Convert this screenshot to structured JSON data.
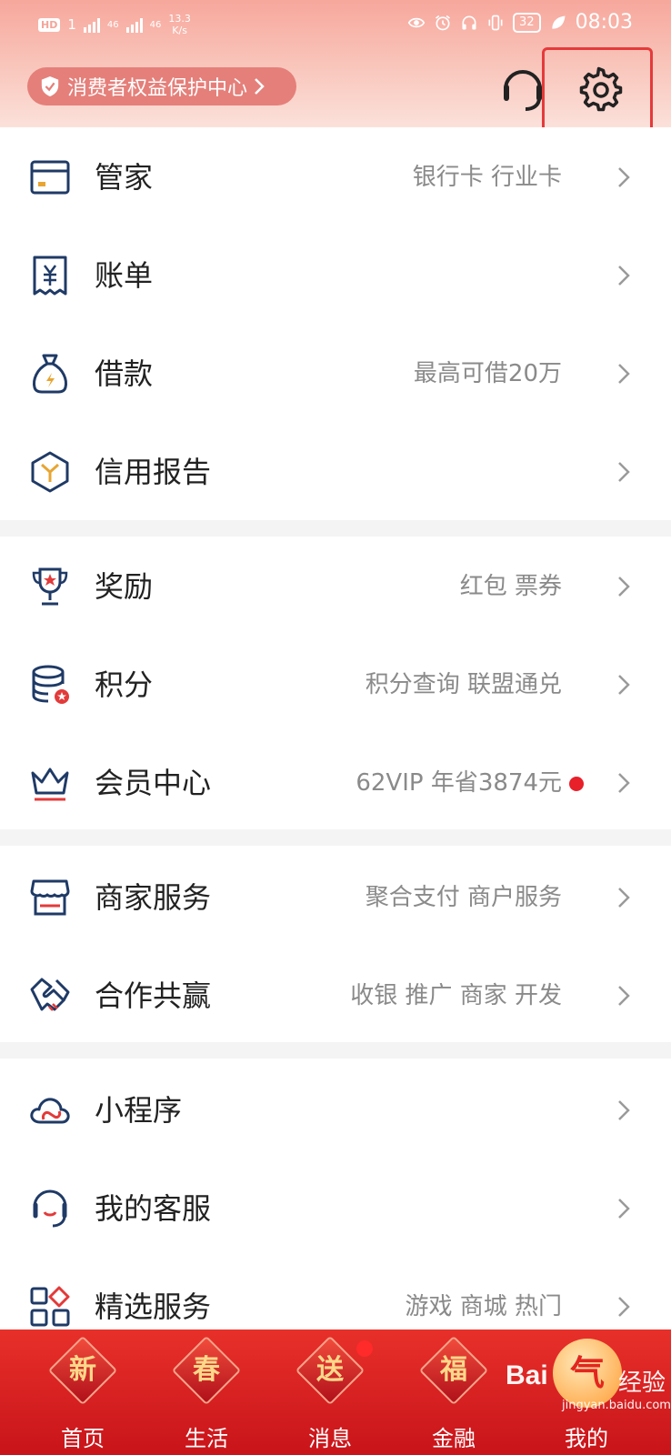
{
  "status_bar": {
    "hd_badge": "HD",
    "sim1": "1",
    "net1": "46",
    "net2": "46",
    "speed_value": "13.3",
    "speed_unit": "K/s",
    "battery": "32",
    "time": "08:03"
  },
  "header": {
    "consumer_center": "消费者权益保护中心"
  },
  "menu": [
    {
      "label": "管家",
      "sub": "银行卡 行业卡",
      "icon": "card-icon"
    },
    {
      "label": "账单",
      "sub": "",
      "icon": "bill-icon"
    },
    {
      "label": "借款",
      "sub": "最高可借20万",
      "icon": "loan-bag-icon"
    },
    {
      "label": "信用报告",
      "sub": "",
      "icon": "credit-report-icon"
    },
    {
      "label": "奖励",
      "sub": "红包 票券",
      "icon": "trophy-icon"
    },
    {
      "label": "积分",
      "sub": "积分查询 联盟通兑",
      "icon": "points-coins-icon"
    },
    {
      "label": "会员中心",
      "sub": "62VIP 年省3874元",
      "icon": "crown-icon"
    },
    {
      "label": "商家服务",
      "sub": "聚合支付 商户服务",
      "icon": "store-icon"
    },
    {
      "label": "合作共赢",
      "sub": "收银 推广 商家 开发",
      "icon": "handshake-icon"
    },
    {
      "label": "小程序",
      "sub": "",
      "icon": "cloud-icon"
    },
    {
      "label": "我的客服",
      "sub": "",
      "icon": "headset-icon"
    },
    {
      "label": "精选服务",
      "sub": "游戏 商城 热门",
      "icon": "apps-grid-icon"
    }
  ],
  "tabbar": [
    {
      "char": "新",
      "label": "首页"
    },
    {
      "char": "春",
      "label": "生活"
    },
    {
      "char": "送",
      "label": "消息"
    },
    {
      "char": "福",
      "label": "金融"
    },
    {
      "char": "气",
      "label": "我的"
    }
  ],
  "watermark": {
    "logo": "Bai",
    "cn": "经验",
    "url": "jingyan.baidu.com"
  },
  "colors": {
    "accent_red": "#e53a3a",
    "icon_navy": "#1f3a66",
    "tab_red": "#d41d1f"
  }
}
